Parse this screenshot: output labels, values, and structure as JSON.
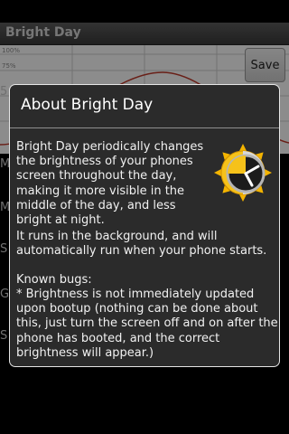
{
  "app": {
    "title": "Bright Day"
  },
  "toolbar": {
    "save_label": "Save"
  },
  "graph": {
    "y_labels": [
      "100%",
      "75%"
    ],
    "colors": {
      "curve": "#c0392b",
      "grid": "#cfcfcf"
    }
  },
  "background_fragments": [
    "5",
    "M",
    "M",
    "S",
    "G",
    "S"
  ],
  "dialog": {
    "title": "About Bright Day",
    "paragraph1": "Bright Day periodically changes the brightness of your phones screen throughout the day, making it more visible in the middle of the day, and less bright at night.",
    "paragraph2": "It runs in the background, and will automatically run when your phone starts.",
    "known_bugs_heading": "Known bugs:",
    "bug1": "* Brightness is not immediately updated upon bootup (nothing can be done about this, just turn the screen off and on after the phone has booted, and the correct brightness will appear.)",
    "icon": "sun-clock-icon"
  }
}
